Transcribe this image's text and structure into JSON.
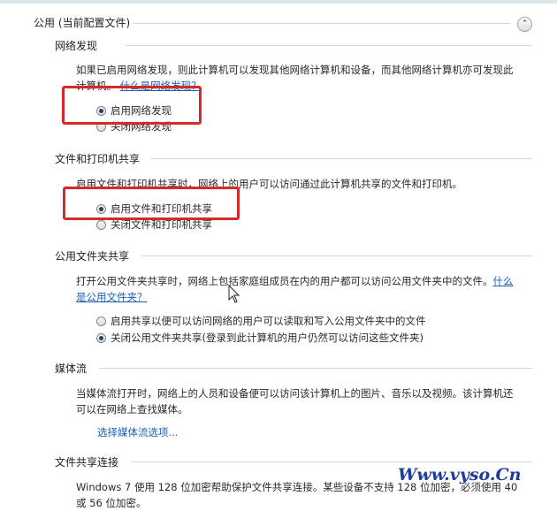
{
  "group": {
    "title": "公用 (当前配置文件)",
    "collapse_icon": "chevron-up-icon"
  },
  "network_discovery": {
    "title": "网络发现",
    "desc": "如果已启用网络发现，则此计算机可以发现其他网络计算机和设备，而其他网络计算机亦可发现此",
    "desc2": "计算机。",
    "link": "什么是网络发现？",
    "options": [
      {
        "label": "启用网络发现",
        "checked": true
      },
      {
        "label": "关闭网络发现",
        "checked": false
      }
    ]
  },
  "file_printer_sharing": {
    "title": "文件和打印机共享",
    "desc": "启用文件和打印机共享时，网络上的用户可以访问通过此计算机共享的文件和打印机。",
    "options": [
      {
        "label": "启用文件和打印机共享",
        "checked": true
      },
      {
        "label": "关闭文件和打印机共享",
        "checked": false
      }
    ]
  },
  "public_folder_sharing": {
    "title": "公用文件夹共享",
    "desc": "打开公用文件夹共享时，网络上包括家庭组成员在内的用户都可以访问公用文件夹中的文件。",
    "link_part1": "什么",
    "link_part2": "是公用文件夹？",
    "options": [
      {
        "label": "启用共享以便可以访问网络的用户可以读取和写入公用文件夹中的文件",
        "checked": false
      },
      {
        "label": "关闭公用文件夹共享(登录到此计算机的用户仍然可以访问这些文件夹)",
        "checked": true
      }
    ]
  },
  "media_streaming": {
    "title": "媒体流",
    "desc": "当媒体流打开时，网络上的人员和设备便可以访问该计算机上的图片、音乐以及视频。该计算机还",
    "desc2": "可以在网络上查找媒体。",
    "link": "选择媒体流选项..."
  },
  "file_sharing_connection": {
    "title": "文件共享连接",
    "desc": "Windows 7 使用 128 位加密帮助保护文件共享连接。某些设备不支持 128 位加密，必须使用 40",
    "desc2": "或 56 位加密。"
  },
  "watermark": {
    "text": "Www.vyso.Cn"
  },
  "colors": {
    "highlight": "#d42a2a",
    "link": "#1a5fb4",
    "watermark": "#1e3c9a"
  }
}
